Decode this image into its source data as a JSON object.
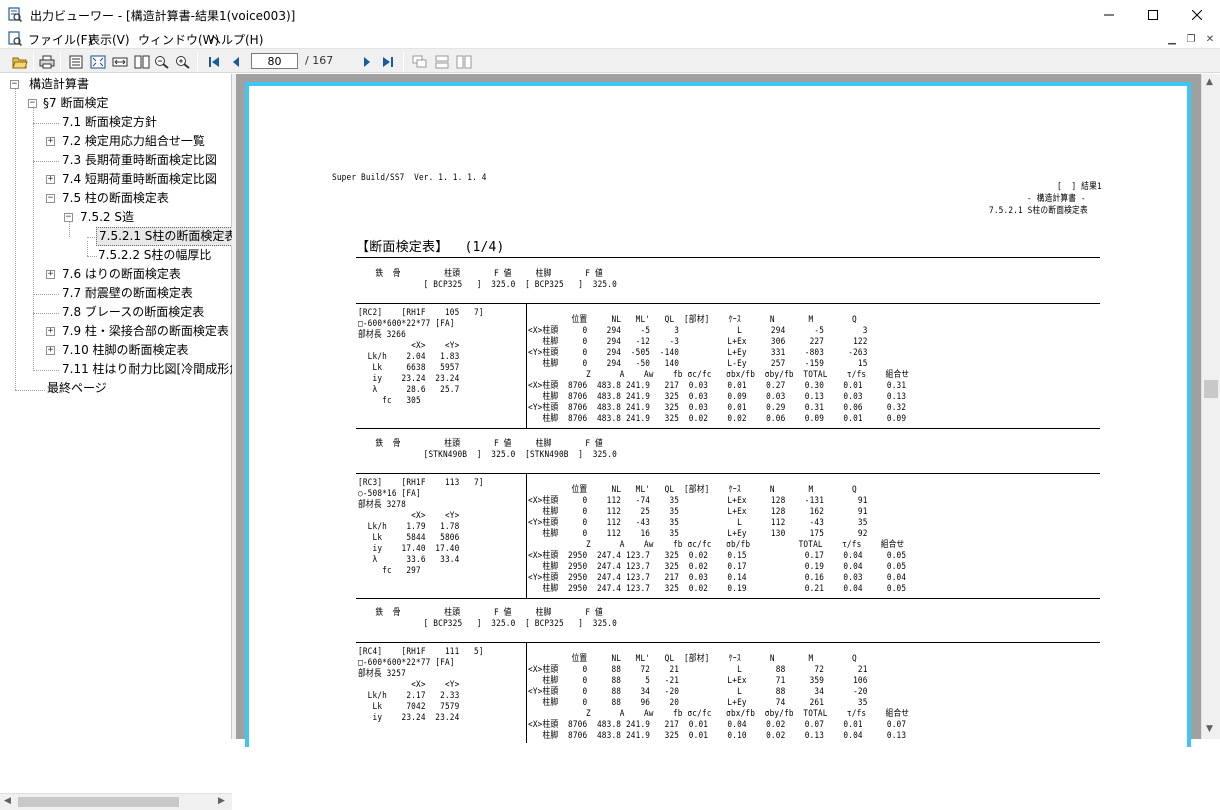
{
  "window": {
    "title": "出力ビューワー - [構造計算書-結果1(voice003)]"
  },
  "menu": [
    {
      "label": "ファイル(F)"
    },
    {
      "label": "表示(V)"
    },
    {
      "label": "ウィンドウ(W)"
    },
    {
      "label": "ヘルプ(H)"
    }
  ],
  "toolbar": {
    "page_current": "80",
    "page_total": "/ 167"
  },
  "tree": [
    {
      "label": "構造計算書"
    },
    {
      "label": "§7 断面検定"
    },
    {
      "label": "7.1 断面検定方針"
    },
    {
      "label": "7.2 検定用応力組合せ一覧"
    },
    {
      "label": "7.3 長期荷重時断面検定比図"
    },
    {
      "label": "7.4 短期荷重時断面検定比図"
    },
    {
      "label": "7.5 柱の断面検定表"
    },
    {
      "label": "7.5.2 S造"
    },
    {
      "label": "7.5.2.1 S柱の断面検定表"
    },
    {
      "label": "7.5.2.2 S柱の幅厚比"
    },
    {
      "label": "7.6 はりの断面検定表"
    },
    {
      "label": "7.7 耐震壁の断面検定表"
    },
    {
      "label": "7.8 ブレースの断面検定表"
    },
    {
      "label": "7.9 柱・梁接合部の断面検定表"
    },
    {
      "label": "7.10 柱脚の断面検定表"
    },
    {
      "label": "7.11 柱はり耐力比図[冷間成形角"
    },
    {
      "label": "最終ページ"
    }
  ],
  "document": {
    "software": "Super Build/SS7  Ver. 1. 1. 1. 4",
    "header_right": [
      "[  ] 結果1",
      "- 構造計算書 -",
      "7.5.2.1 S柱の断面検定表"
    ],
    "table_title": "【断面検定表】  (1/4)",
    "sections": [
      {
        "mat_head": "    鉄  骨         柱頭       F 値     柱脚       F 値",
        "mat_vals": "              [ BCP325   ]  325.0  [ BCP325   ]  325.0",
        "left": [
          "[RC2]    [RH1F    105   7]",
          "□-600*600*22*77 [FA]",
          "部材長 3266",
          "           <X>    <Y>",
          "  Lk/h    2.04   1.83",
          "   Lk     6638   5957",
          "   iy    23.24  23.24",
          "   λ      28.6   25.7",
          "     fc   305"
        ],
        "right": [
          "         位置     NL   ML'   QL  [部材]    ｹｰｽ      N       M        Q",
          "<X>柱頭     0    294    -5     3            L      294      -5        3",
          "   柱脚     0    294   -12    -3          L+Ex     306     227      122",
          "<Y>柱頭     0    294  -505  -140          L+Ey     331    -803     -263",
          "   柱脚     0    294   -50   140          L-Ey     257    -159       15",
          "            Z      A    Aw    fb σc/fc   σbx/fb  σby/fb  TOTAL    τ/fs    組合せ",
          "<X>柱頭  8706  483.8 241.9   217  0.03    0.01    0.27    0.30    0.01     0.31",
          "   柱脚  8706  483.8 241.9   325  0.03    0.09    0.03    0.13    0.03     0.13",
          "<Y>柱頭  8706  483.8 241.9   325  0.03    0.01    0.29    0.31    0.06     0.32",
          "   柱脚  8706  483.8 241.9   325  0.02    0.02    0.06    0.09    0.01     0.09"
        ]
      },
      {
        "mat_head": "    鉄  骨         柱頭       F 値     柱脚       F 値",
        "mat_vals": "              [STKN490B  ]  325.0  [STKN490B  ]  325.0",
        "left": [
          "[RC3]    [RH1F    113   7]",
          "○-508*16 [FA]",
          "部材長 3278",
          "           <X>    <Y>",
          "  Lk/h    1.79   1.78",
          "   Lk     5844   5806",
          "   iy    17.40  17.40",
          "   λ      33.6   33.4",
          "     fc   297"
        ],
        "right": [
          "         位置     NL   ML'   QL  [部材]    ｹｰｽ      N       M        Q",
          "<X>柱頭     0    112   -74    35          L+Ex     128    -131       91",
          "   柱脚     0    112    25    35          L+Ex     128     162       91",
          "<Y>柱頭     0    112   -43    35            L      112     -43       35",
          "   柱脚     0    112    16    35          L+Ey     130     175       92",
          "            Z      A    Aw    fb σc/fc   σb/fb          TOTAL    τ/fs    組合せ",
          "<X>柱頭  2950  247.4 123.7   325  0.02    0.15            0.17    0.04     0.05",
          "   柱脚  2950  247.4 123.7   325  0.02    0.17            0.19    0.04     0.05",
          "<Y>柱頭  2950  247.4 123.7   217  0.03    0.14            0.16    0.03     0.04",
          "   柱脚  2950  247.4 123.7   325  0.02    0.19            0.21    0.04     0.05"
        ]
      },
      {
        "mat_head": "    鉄  骨         柱頭       F 値     柱脚       F 値",
        "mat_vals": "              [ BCP325   ]  325.0  [ BCP325   ]  325.0",
        "left": [
          "[RC4]    [RH1F    111   5]",
          "□-600*600*22*77 [FA]",
          "部材長 3257",
          "           <X>    <Y>",
          "  Lk/h    2.17   2.33",
          "   Lk     7042   7579",
          "   iy    23.24  23.24"
        ],
        "right": [
          "         位置     NL   ML'   QL  [部材]    ｹｰｽ      N       M        Q",
          "<X>柱頭     0     88    72    21            L       88      72       21",
          "   柱脚     0     88     5   -21          L+Ex      71     359      106",
          "<Y>柱頭     0     88    34   -20            L       88      34      -20",
          "   柱脚     0     88    96    20          L+Ey      74     261       35",
          "            Z      A    Aw    fb σc/fc   σbx/fb  σby/fb  TOTAL    τ/fs    組合せ",
          "<X>柱頭  8706  483.8 241.9   217  0.01    0.04    0.02    0.07    0.01     0.07",
          "   柱脚  8706  483.8 241.9   325  0.01    0.10    0.02    0.13    0.04     0.13"
        ]
      }
    ]
  }
}
